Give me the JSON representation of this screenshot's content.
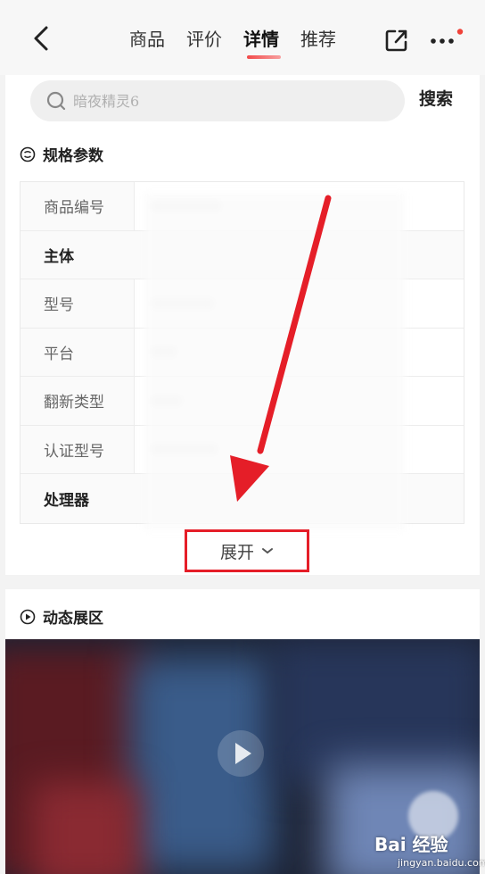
{
  "nav": {
    "tabs": [
      {
        "label": "商品"
      },
      {
        "label": "评价"
      },
      {
        "label": "详情"
      },
      {
        "label": "推荐"
      }
    ],
    "active_tab": "详情",
    "back_icon": "chevron-left-icon",
    "share_icon": "share-icon",
    "more_icon": "more-dots-icon",
    "notification_dot_color": "#f0433a"
  },
  "search": {
    "placeholder": "暗夜精灵6",
    "button_label": "搜索"
  },
  "specs": {
    "title": "规格参数",
    "rows": [
      {
        "key": "商品编号"
      },
      {
        "key": "主体"
      },
      {
        "key": "型号"
      },
      {
        "key": "平台"
      },
      {
        "key": "翻新类型"
      },
      {
        "key": "认证型号"
      },
      {
        "key": "处理器"
      }
    ],
    "expand_label": "展开"
  },
  "dynamic": {
    "title": "动态展区"
  },
  "watermark": {
    "brand": "Bai 经验",
    "url": "jingyan.baidu.com"
  },
  "colors": {
    "accent": "#e51e28",
    "tab_underline": "#f24a4a"
  }
}
